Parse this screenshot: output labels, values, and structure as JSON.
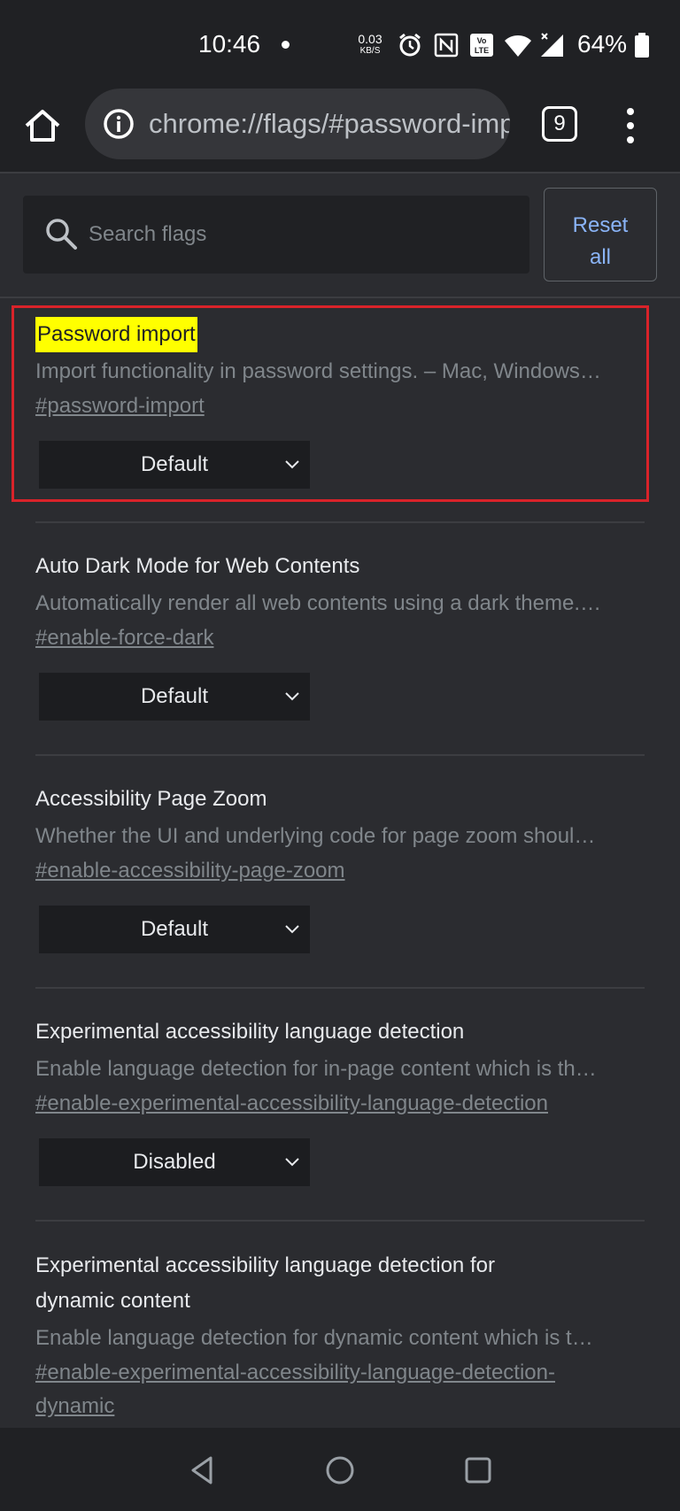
{
  "status_bar": {
    "time": "10:46",
    "net_speed_value": "0.03",
    "net_speed_unit": "KB/S",
    "battery_percent": "64%",
    "icons": [
      "alarm-icon",
      "nfc-icon",
      "volte-icon",
      "wifi-icon",
      "signal-icon",
      "battery-icon"
    ]
  },
  "toolbar": {
    "url": "chrome://flags/#password-import",
    "tab_count": "9"
  },
  "search": {
    "placeholder": "Search flags",
    "value": ""
  },
  "reset_button": {
    "line1": "Reset",
    "line2": "all"
  },
  "flags": [
    {
      "title": "Password import",
      "description": "Import functionality in password settings. – Mac, Windows…",
      "link": "#password-import",
      "selected": "Default",
      "highlighted": true
    },
    {
      "title": "Auto Dark Mode for Web Contents",
      "description": "Automatically render all web contents using a dark theme.…",
      "link": "#enable-force-dark",
      "selected": "Default"
    },
    {
      "title": "Accessibility Page Zoom",
      "description": "Whether the UI and underlying code for page zoom shoul…",
      "link": "#enable-accessibility-page-zoom",
      "selected": "Default"
    },
    {
      "title": "Experimental accessibility language detection",
      "description": "Enable language detection for in-page content which is th…",
      "link": "#enable-experimental-accessibility-language-detection",
      "selected": "Disabled"
    },
    {
      "title_line1": "Experimental accessibility language detection for",
      "title_line2": "dynamic content",
      "description": "Enable language detection for dynamic content which is t…",
      "link_line1": "#enable-experimental-accessibility-language-detection-",
      "link_line2": "dynamic"
    }
  ],
  "colors": {
    "background": "#2b2c30",
    "toolbar": "#202124",
    "accent": "#8ab4f8",
    "highlight": "#ffff00",
    "highlight_box": "#d9232a"
  }
}
